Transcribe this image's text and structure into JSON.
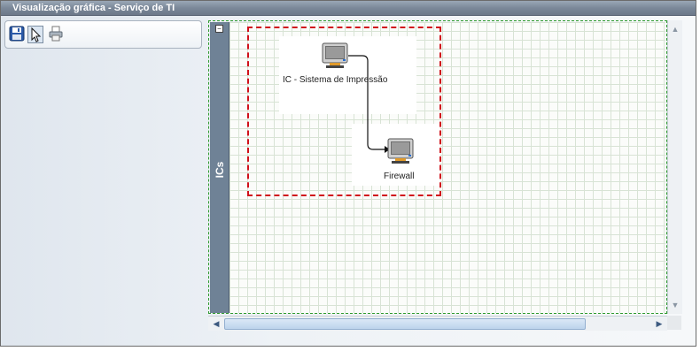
{
  "window": {
    "title": "Visualização gráfica - Serviço de TI"
  },
  "toolbar": {
    "buttons": [
      {
        "name": "save",
        "icon": "floppy-disk-icon"
      },
      {
        "name": "select",
        "icon": "pointer-arrow-icon",
        "active": true
      },
      {
        "name": "print",
        "icon": "printer-icon"
      }
    ]
  },
  "lane": {
    "label": "ICs",
    "collapse_symbol": "−"
  },
  "diagram": {
    "nodes": [
      {
        "label": "IC - Sistema de Impressão",
        "icon": "computer-icon"
      },
      {
        "label": "Firewall",
        "icon": "computer-icon"
      }
    ],
    "connection": {
      "from": "IC - Sistema de Impressão",
      "to": "Firewall"
    },
    "selection_color": "#d0101a"
  },
  "scrollbars": {
    "up_arrow": "▲",
    "down_arrow": "▼",
    "left_arrow": "◀",
    "right_arrow": "▶"
  }
}
